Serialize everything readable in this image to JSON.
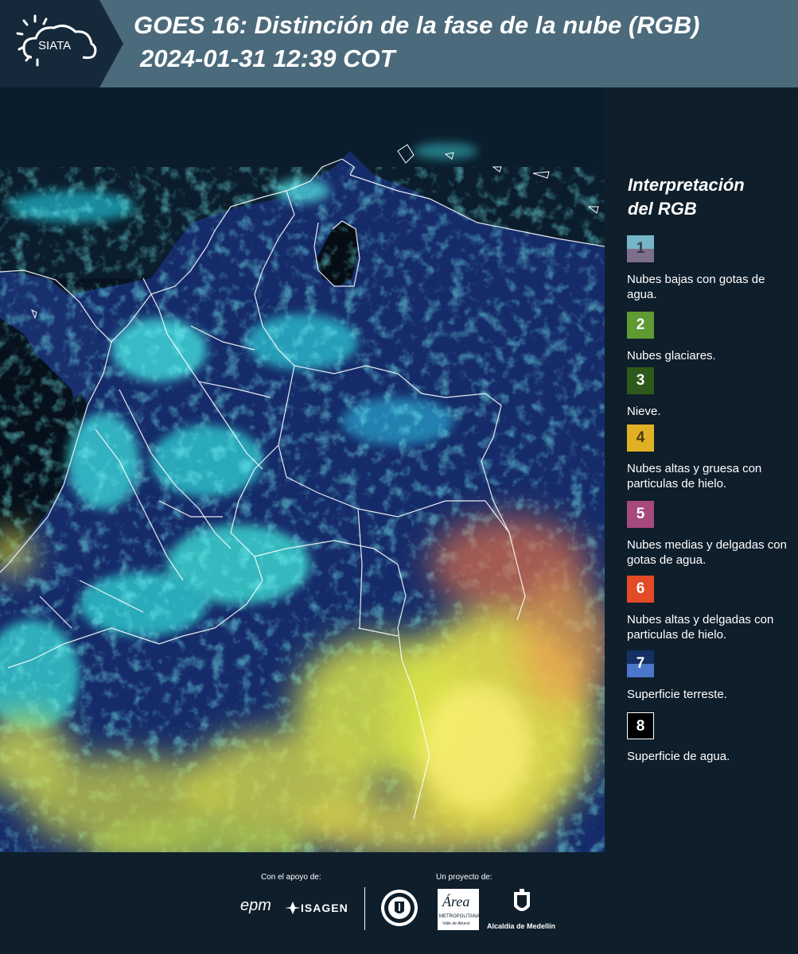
{
  "header": {
    "logo_text": "SIATA",
    "title_line1": "GOES 16: Distinción de la fase de la nube (RGB)",
    "title_line2": "2024-01-31 12:39 COT"
  },
  "legend": {
    "title_line1": "Interpretación",
    "title_line2": "del RGB",
    "items": [
      {
        "number": "1",
        "label": "Nubes bajas con gotas de agua.",
        "color_top": "#76b6c7",
        "color_bottom": "#7d6e8b",
        "num_color": "#3a3a46"
      },
      {
        "number": "2",
        "label": "Nubes glaciares.",
        "color": "#5f9a32",
        "num_color": "#ffffff"
      },
      {
        "number": "3",
        "label": "Nieve.",
        "color": "#2d5a1b",
        "num_color": "#ffffff"
      },
      {
        "number": "4",
        "label": "Nubes altas y gruesa con particulas de hielo.",
        "color": "#e0b125",
        "num_color": "#4a3b10"
      },
      {
        "number": "5",
        "label": "Nubes medias y delgadas con gotas de agua.",
        "color": "#a7497d",
        "num_color": "#ffffff"
      },
      {
        "number": "6",
        "label": "Nubes altas y delgadas con particulas de hielo.",
        "color": "#e34a25",
        "num_color": "#ffffff"
      },
      {
        "number": "7",
        "label": "Superficie terreste.",
        "color_top": "#142f63",
        "color_bottom": "#4a77c9",
        "num_color": "#ffffff"
      },
      {
        "number": "8",
        "label": "Superficie de agua.",
        "color": "#000000",
        "num_color": "#ffffff",
        "border": "#ffffff"
      }
    ]
  },
  "footer": {
    "support_label": "Con el apoyo de:",
    "project_label": "Un proyecto de:",
    "sponsors": {
      "epm": "epm",
      "isagen": "ISAGEN",
      "area_name": "Área",
      "area_sub1": "METROPOLITANA",
      "area_sub2": "Valle de Aburrá",
      "alcaldia": "Alcaldía de Medellín"
    }
  }
}
